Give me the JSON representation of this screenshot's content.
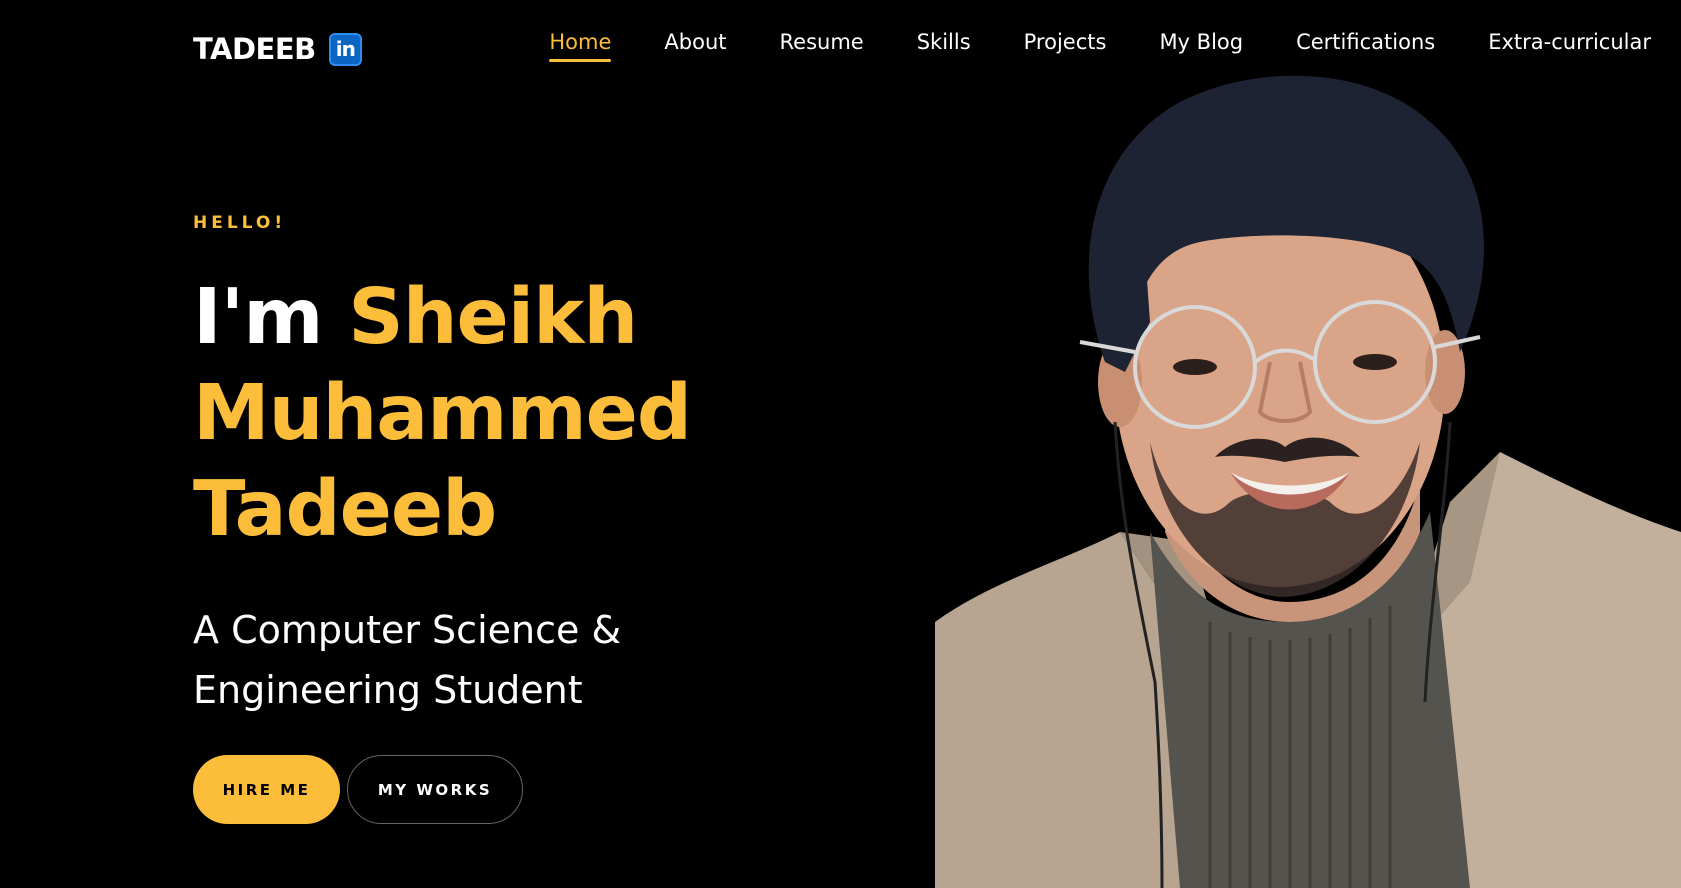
{
  "brand": {
    "name": "TADEEB",
    "social_icon": "linkedin-icon",
    "social_icon_text": "in"
  },
  "nav": {
    "items": [
      {
        "label": "Home",
        "active": true
      },
      {
        "label": "About"
      },
      {
        "label": "Resume"
      },
      {
        "label": "Skills"
      },
      {
        "label": "Projects"
      },
      {
        "label": "My Blog"
      },
      {
        "label": "Certifications"
      },
      {
        "label": "Extra-curricular"
      }
    ]
  },
  "hero": {
    "greeting": "HELLO!",
    "intro": "I'm",
    "name_line1": "Sheikh",
    "name_line2": "Muhammed",
    "name_line3": "Tadeeb",
    "subtitle": "A Computer Science & Engineering Student",
    "primary_button": "HIRE ME",
    "secondary_button": "MY WORKS"
  },
  "colors": {
    "accent": "#fbbd3a",
    "background": "#000000",
    "text": "#ffffff",
    "linkedin": "#0a66c2"
  }
}
